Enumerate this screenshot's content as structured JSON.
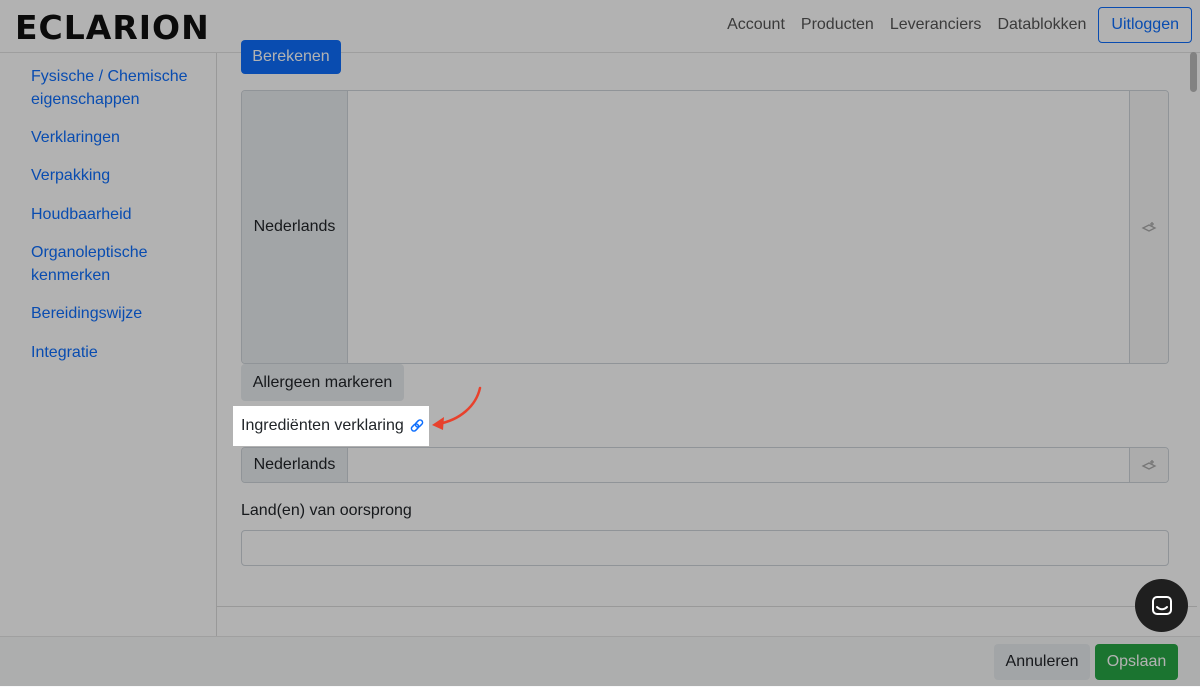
{
  "header": {
    "logo": "ECLARION",
    "nav": [
      "Account",
      "Producten",
      "Leveranciers",
      "Datablokken"
    ],
    "logout": "Uitloggen"
  },
  "sidebar": {
    "items": [
      {
        "label": "Fysische / Chemische eigenschappen"
      },
      {
        "label": "Verklaringen"
      },
      {
        "label": "Verpakking"
      },
      {
        "label": "Houdbaarheid"
      },
      {
        "label": "Organoleptische kenmerken"
      },
      {
        "label": "Bereidingswijze"
      },
      {
        "label": "Integratie"
      }
    ]
  },
  "main": {
    "calculate_button": "Berekenen",
    "textarea_language": "Nederlands",
    "allergen_button": "Allergeen markeren",
    "ingredient_label": "Ingrediënten verklaring",
    "ingredient_language": "Nederlands",
    "origin_label": "Land(en) van oorsprong",
    "origin_value": ""
  },
  "footer": {
    "cancel": "Annuleren",
    "save": "Opslaan"
  },
  "icons": {
    "link": "link-icon",
    "translate": "translate-icon",
    "chat": "chat-icon",
    "arrow": "annotation-arrow"
  },
  "colors": {
    "primary": "#0d6efd",
    "success": "#28a745",
    "annotation": "#e8412c"
  }
}
